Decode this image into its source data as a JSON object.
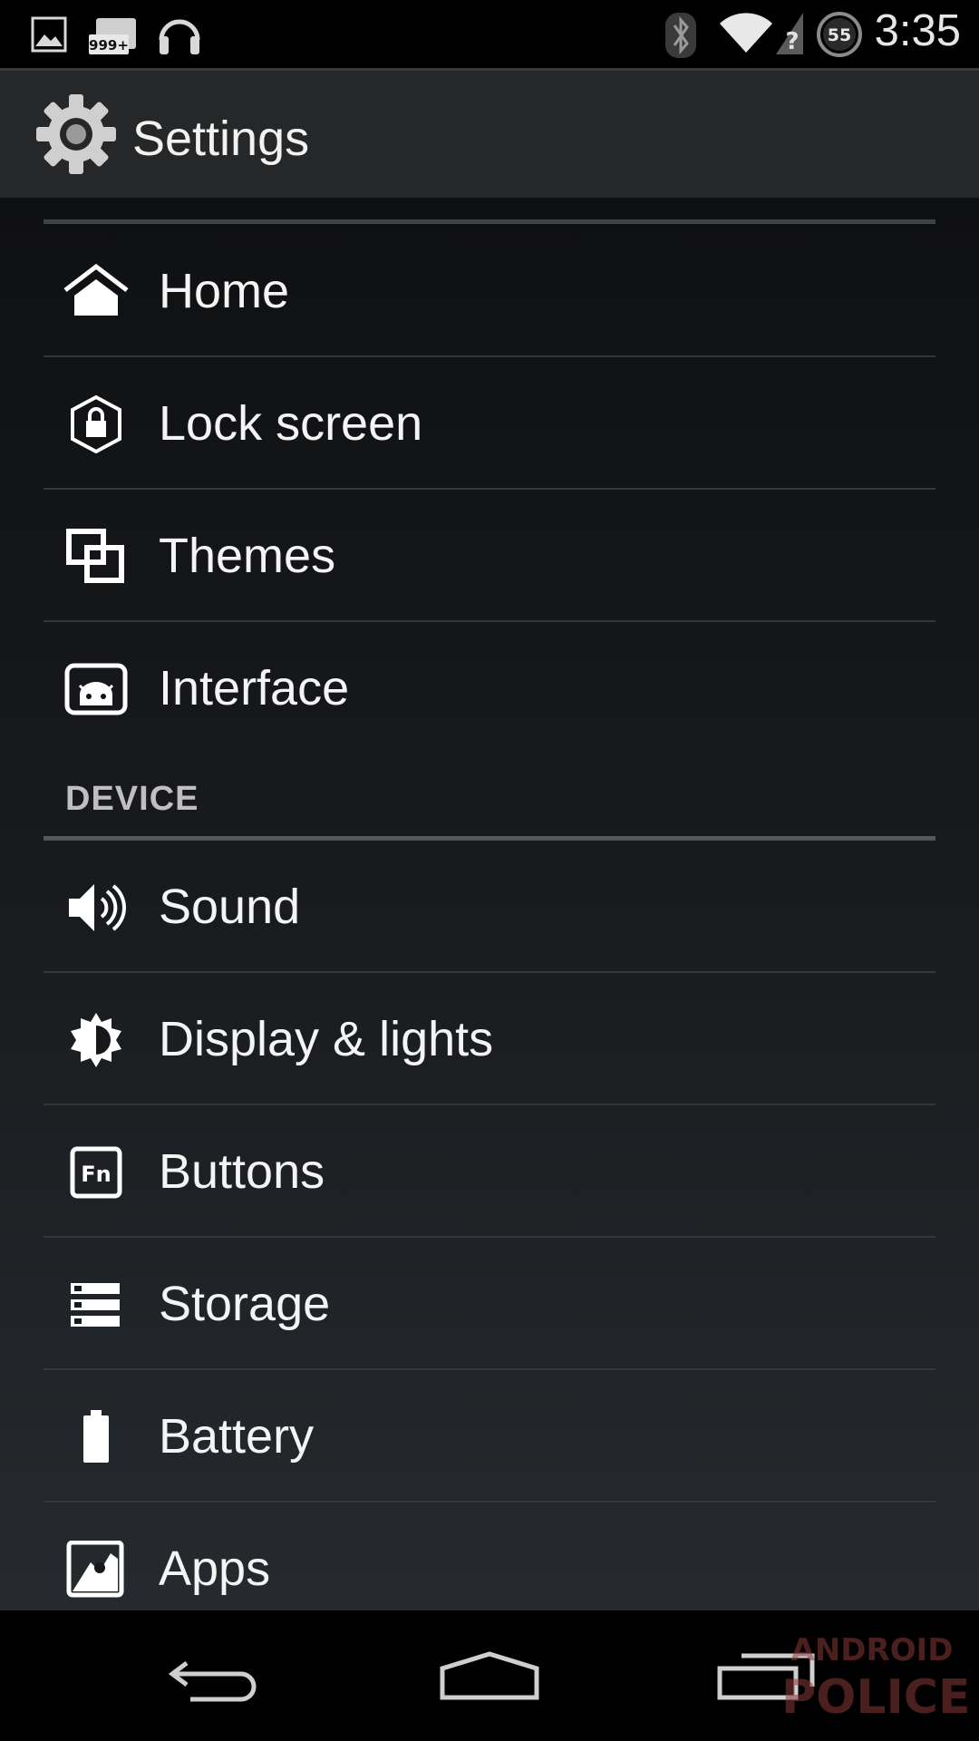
{
  "status_bar": {
    "time": "3:35",
    "notification_count": "999+",
    "battery_level": "55",
    "icons": [
      "picture-icon",
      "notification-count-icon",
      "headphones-icon",
      "bluetooth-icon",
      "wifi-icon",
      "no-signal-icon",
      "battery-icon"
    ]
  },
  "action_bar": {
    "title": "Settings",
    "icon": "gear-icon"
  },
  "sections": {
    "personal_items": [
      {
        "label": "Home",
        "icon": "home-icon"
      },
      {
        "label": "Lock screen",
        "icon": "lock-icon"
      },
      {
        "label": "Themes",
        "icon": "themes-icon"
      },
      {
        "label": "Interface",
        "icon": "interface-icon"
      }
    ],
    "device": {
      "header": "DEVICE",
      "items": [
        {
          "label": "Sound",
          "icon": "speaker-icon"
        },
        {
          "label": "Display & lights",
          "icon": "brightness-icon"
        },
        {
          "label": "Buttons",
          "icon": "fn-key-icon"
        },
        {
          "label": "Storage",
          "icon": "storage-icon"
        },
        {
          "label": "Battery",
          "icon": "battery-icon"
        },
        {
          "label": "Apps",
          "icon": "apps-icon"
        }
      ]
    }
  },
  "watermark": {
    "line1": "ANDROID",
    "line2": "POLICE"
  },
  "nav_bar": {
    "buttons": [
      "back-icon",
      "home-nav-icon",
      "recents-icon"
    ]
  },
  "colors": {
    "background": "#000000",
    "action_bar": "#262728",
    "text": "#f4f4f4",
    "section_header": "#bfbfbf"
  }
}
